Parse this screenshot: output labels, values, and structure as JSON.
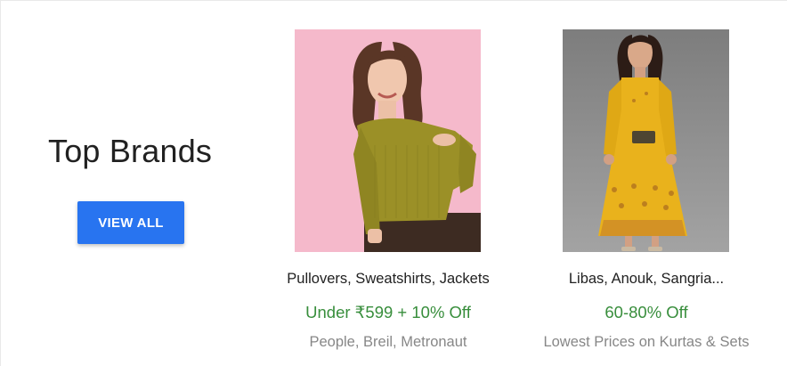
{
  "section": {
    "title": "Top Brands",
    "view_all_label": "VIEW ALL"
  },
  "cards": [
    {
      "name": "Pullovers, Sweatshirts, Jackets",
      "offer": "Under ₹599 + 10% Off",
      "subtitle": "People, Breil, Metronaut",
      "image": "woman-in-mustard-sweater-photo"
    },
    {
      "name": "Libas, Anouk, Sangria...",
      "offer": "60-80% Off",
      "subtitle": "Lowest Prices on Kurtas & Sets",
      "image": "woman-in-yellow-kurta-dress-photo"
    }
  ],
  "colors": {
    "accent": "#2874f0",
    "offer": "#388e3c",
    "muted": "#878787"
  }
}
